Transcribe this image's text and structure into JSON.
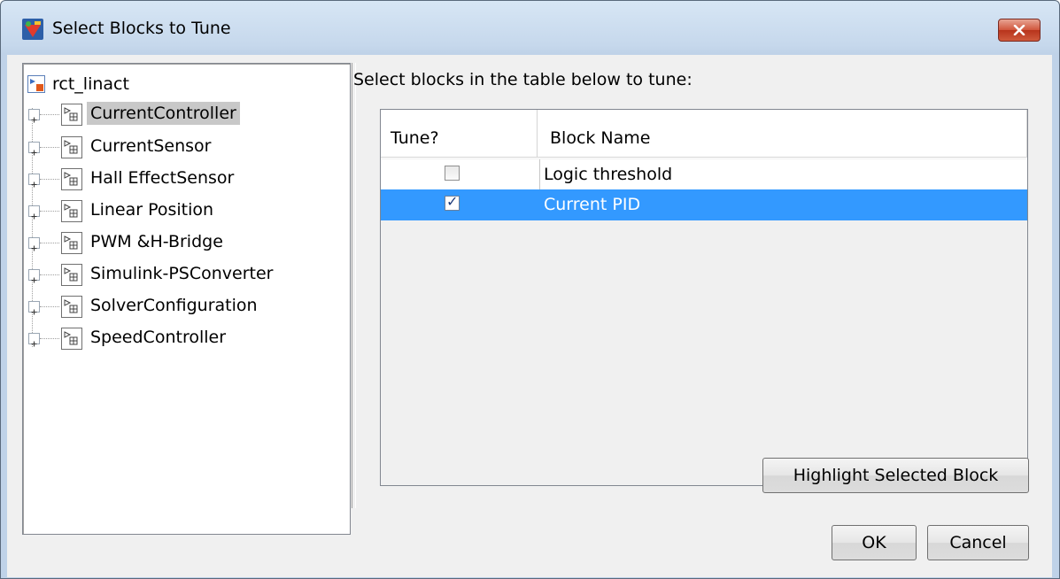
{
  "window": {
    "title": "Select Blocks to Tune"
  },
  "tree": {
    "root": "rct_linact",
    "items": [
      {
        "label": "CurrentController",
        "selected": true
      },
      {
        "label": "CurrentSensor",
        "selected": false
      },
      {
        "label": "Hall EffectSensor",
        "selected": false
      },
      {
        "label": "Linear Position",
        "selected": false
      },
      {
        "label": "PWM &H-Bridge",
        "selected": false
      },
      {
        "label": "Simulink-PSConverter",
        "selected": false
      },
      {
        "label": "SolverConfiguration",
        "selected": false
      },
      {
        "label": "SpeedController",
        "selected": false
      }
    ]
  },
  "main": {
    "instruction": "Select blocks in the table below to tune:",
    "table": {
      "columns": [
        "Tune?",
        "Block Name"
      ],
      "rows": [
        {
          "tune": false,
          "name": "Logic threshold"
        },
        {
          "tune": true,
          "name": "Current PID"
        }
      ]
    },
    "highlight_button": "Highlight Selected Block"
  },
  "footer": {
    "ok_label": "OK",
    "cancel_label": "Cancel"
  },
  "colors": {
    "selection": "#3399ff",
    "tree_selection": "#c8c8c8",
    "close": "#c9462c"
  }
}
